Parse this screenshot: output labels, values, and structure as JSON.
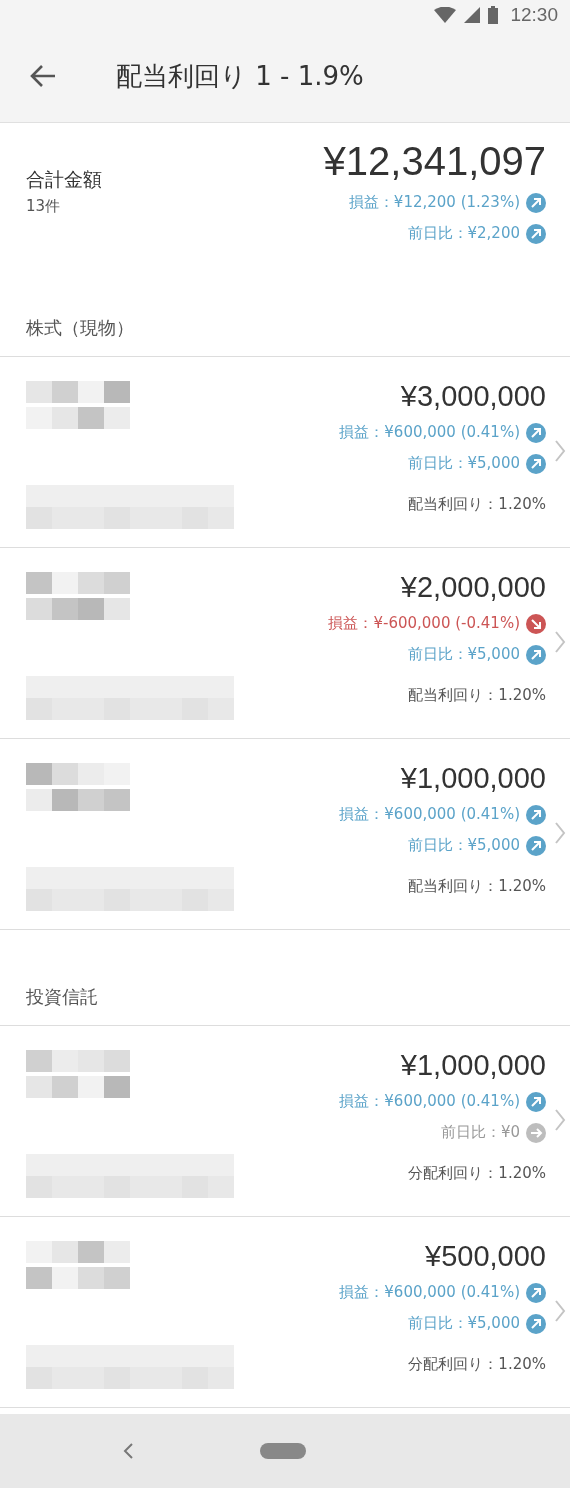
{
  "status_bar": {
    "time": "12:30"
  },
  "app_bar": {
    "title": "配当利回り 1 - 1.9%"
  },
  "summary": {
    "label": "合計金額",
    "count": "13件",
    "total": "¥12,341,097",
    "gain": {
      "text": "損益：¥12,200 (1.23%)",
      "kind": "up"
    },
    "day_change": {
      "text": "前日比：¥2,200",
      "kind": "up"
    }
  },
  "sections": [
    {
      "title": "株式（現物）",
      "holdings": [
        {
          "amount": "¥3,000,000",
          "gain": {
            "text": "損益：¥600,000 (0.41%)",
            "kind": "up"
          },
          "day_change": {
            "text": "前日比：¥5,000",
            "kind": "up"
          },
          "yield": "配当利回り：1.20%"
        },
        {
          "amount": "¥2,000,000",
          "gain": {
            "text": "損益：¥-600,000 (-0.41%)",
            "kind": "down"
          },
          "day_change": {
            "text": "前日比：¥5,000",
            "kind": "up"
          },
          "yield": "配当利回り：1.20%"
        },
        {
          "amount": "¥1,000,000",
          "gain": {
            "text": "損益：¥600,000 (0.41%)",
            "kind": "up"
          },
          "day_change": {
            "text": "前日比：¥5,000",
            "kind": "up"
          },
          "yield": "配当利回り：1.20%"
        }
      ]
    },
    {
      "title": "投資信託",
      "holdings": [
        {
          "amount": "¥1,000,000",
          "gain": {
            "text": "損益：¥600,000 (0.41%)",
            "kind": "up"
          },
          "day_change": {
            "text": "前日比：¥0",
            "kind": "flat"
          },
          "yield": "分配利回り：1.20%"
        },
        {
          "amount": "¥500,000",
          "gain": {
            "text": "損益：¥600,000 (0.41%)",
            "kind": "up"
          },
          "day_change": {
            "text": "前日比：¥5,000",
            "kind": "up"
          },
          "yield": "分配利回り：1.20%"
        }
      ]
    }
  ]
}
